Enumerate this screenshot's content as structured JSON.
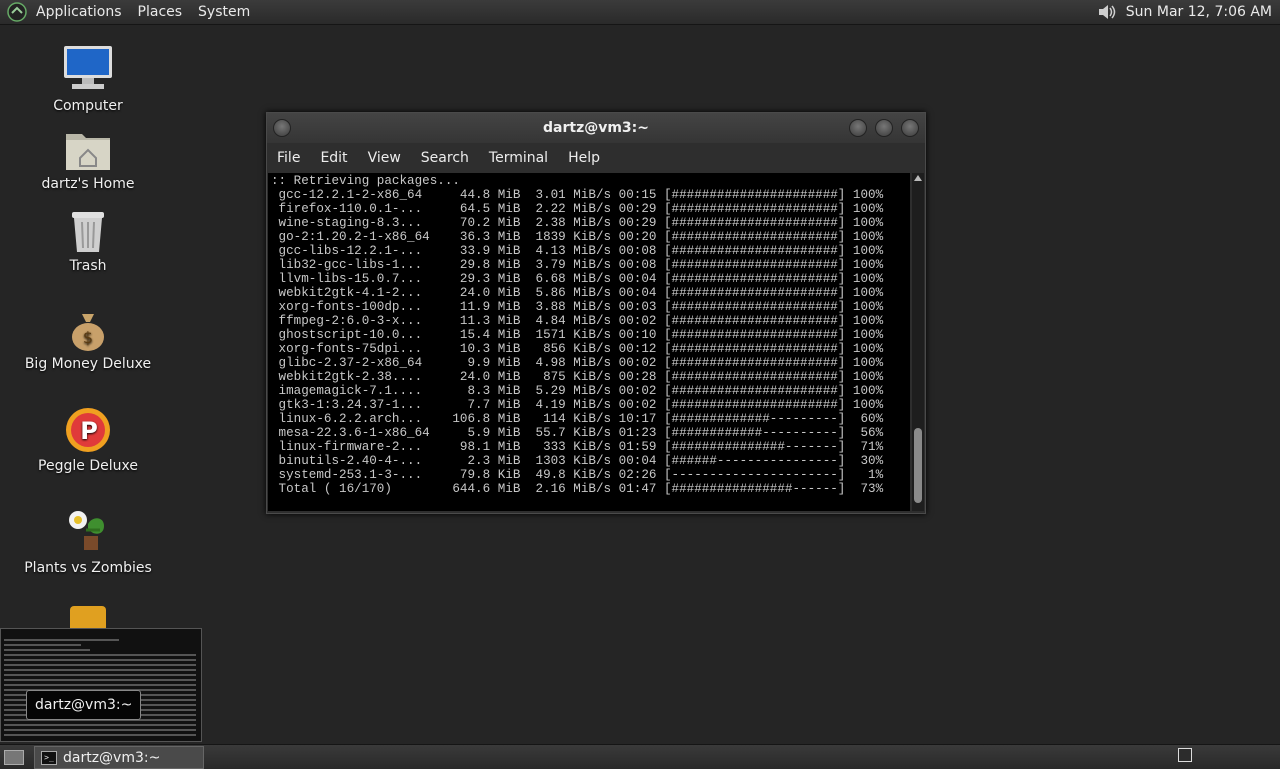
{
  "top_panel": {
    "menus": [
      "Applications",
      "Places",
      "System"
    ],
    "clock": "Sun Mar 12,  7:06 AM"
  },
  "desktop_icons": [
    {
      "label": "Computer",
      "icon": "computer-icon"
    },
    {
      "label": "dartz's Home",
      "icon": "home-folder-icon"
    },
    {
      "label": "Trash",
      "icon": "trash-icon"
    },
    {
      "label": "Big Money Deluxe",
      "icon": "money-bag-icon"
    },
    {
      "label": "Peggle Deluxe",
      "icon": "peggle-icon"
    },
    {
      "label": "Plants vs Zombies",
      "icon": "plants-icon"
    }
  ],
  "terminal": {
    "title": "dartz@vm3:~",
    "menus": [
      "File",
      "Edit",
      "View",
      "Search",
      "Terminal",
      "Help"
    ],
    "lines": [
      ":: Retrieving packages...",
      " gcc-12.2.1-2-x86_64     44.8 MiB  3.01 MiB/s 00:15 [######################] 100%",
      " firefox-110.0.1-...     64.5 MiB  2.22 MiB/s 00:29 [######################] 100%",
      " wine-staging-8.3...     70.2 MiB  2.38 MiB/s 00:29 [######################] 100%",
      " go-2:1.20.2-1-x86_64    36.3 MiB  1839 KiB/s 00:20 [######################] 100%",
      " gcc-libs-12.2.1-...     33.9 MiB  4.13 MiB/s 00:08 [######################] 100%",
      " lib32-gcc-libs-1...     29.8 MiB  3.79 MiB/s 00:08 [######################] 100%",
      " llvm-libs-15.0.7...     29.3 MiB  6.68 MiB/s 00:04 [######################] 100%",
      " webkit2gtk-4.1-2...     24.0 MiB  5.86 MiB/s 00:04 [######################] 100%",
      " xorg-fonts-100dp...     11.9 MiB  3.88 MiB/s 00:03 [######################] 100%",
      " ffmpeg-2:6.0-3-x...     11.3 MiB  4.84 MiB/s 00:02 [######################] 100%",
      " ghostscript-10.0...     15.4 MiB  1571 KiB/s 00:10 [######################] 100%",
      " xorg-fonts-75dpi...     10.3 MiB   856 KiB/s 00:12 [######################] 100%",
      " glibc-2.37-2-x86_64      9.9 MiB  4.98 MiB/s 00:02 [######################] 100%",
      " webkit2gtk-2.38....     24.0 MiB   875 KiB/s 00:28 [######################] 100%",
      " imagemagick-7.1....      8.3 MiB  5.29 MiB/s 00:02 [######################] 100%",
      " gtk3-1:3.24.37-1...      7.7 MiB  4.19 MiB/s 00:02 [######################] 100%",
      " linux-6.2.2.arch...    106.8 MiB   114 KiB/s 10:17 [#############---------]  60%",
      " mesa-22.3.6-1-x86_64     5.9 MiB  55.7 KiB/s 01:23 [############----------]  56%",
      " linux-firmware-2...     98.1 MiB   333 KiB/s 01:59 [###############-------]  71%",
      " binutils-2.40-4-...      2.3 MiB  1303 KiB/s 00:04 [######----------------]  30%",
      " systemd-253.1-3-...     79.8 KiB  49.8 KiB/s 02:26 [----------------------]   1%",
      " Total ( 16/170)        644.6 MiB  2.16 MiB/s 01:47 [################------]  73%"
    ]
  },
  "taskbar": {
    "preview_label": "dartz@vm3:~",
    "task_label": "dartz@vm3:~",
    "task_icon_glyph": ">_"
  }
}
